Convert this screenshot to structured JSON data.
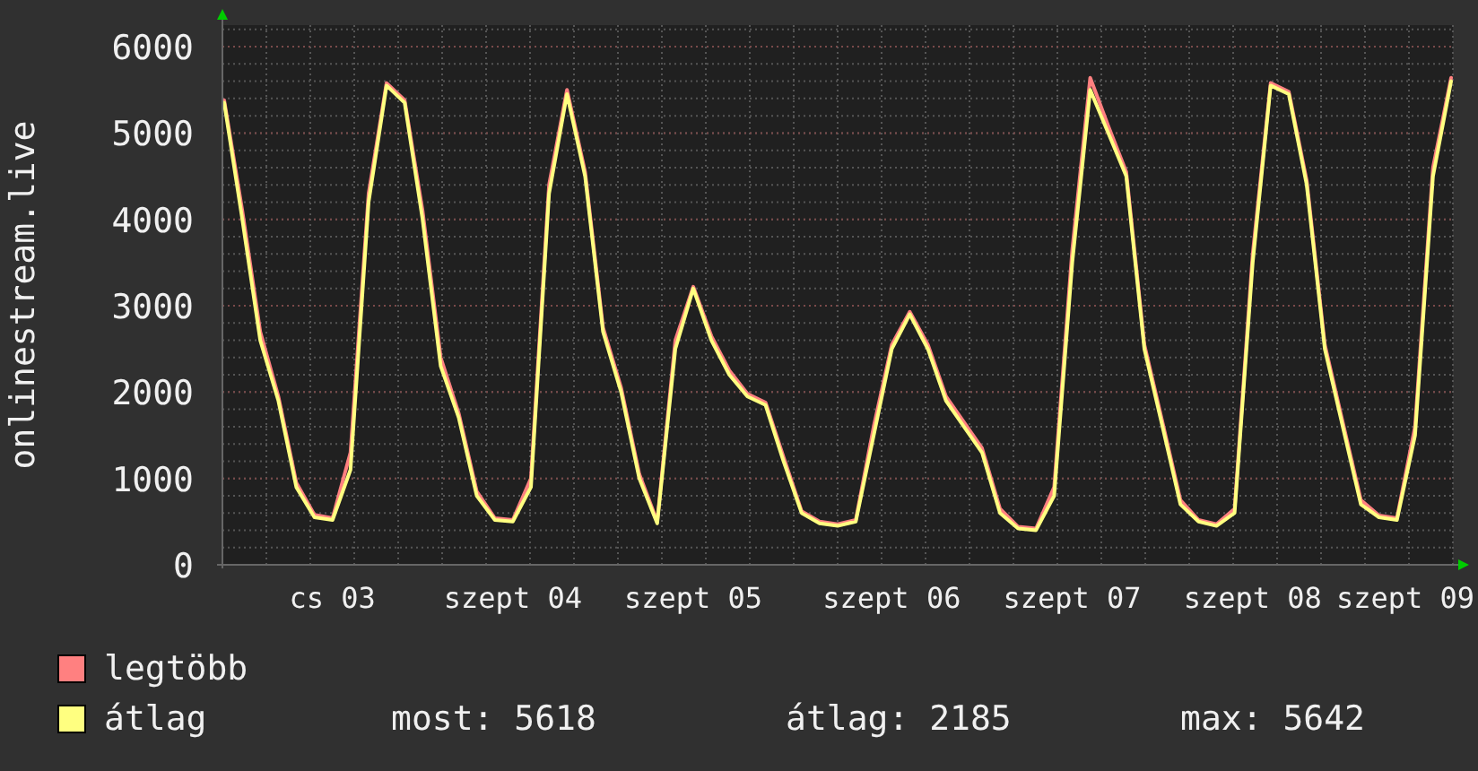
{
  "chart": {
    "chart_data": {
      "type": "line",
      "ylabel": "onlinestream.live",
      "categories": [
        null,
        null,
        null,
        null,
        null,
        null,
        "cs 03",
        null,
        null,
        null,
        null,
        null,
        null,
        null,
        null,
        null,
        "szept 04",
        null,
        null,
        null,
        null,
        null,
        null,
        null,
        null,
        null,
        "szept 05",
        null,
        null,
        null,
        null,
        null,
        null,
        null,
        null,
        null,
        null,
        "szept 06",
        null,
        null,
        null,
        null,
        null,
        null,
        null,
        null,
        null,
        "szept 07",
        null,
        null,
        null,
        null,
        null,
        null,
        null,
        null,
        null,
        "szept 08",
        null,
        null,
        null,
        null,
        null,
        null,
        null,
        null,
        "szept 09",
        null,
        null
      ],
      "ylim": [
        0,
        6250
      ],
      "grid": true,
      "yticks": [
        0,
        1000,
        2000,
        3000,
        4000,
        5000,
        6000
      ],
      "series": [
        {
          "name": "legtöbb",
          "color": "#ff8080",
          "values": [
            5380,
            4100,
            2700,
            1950,
            950,
            580,
            540,
            1300,
            4300,
            5580,
            5380,
            4100,
            2400,
            1750,
            850,
            540,
            520,
            1000,
            4400,
            5500,
            4550,
            2750,
            2050,
            1050,
            500,
            2600,
            3220,
            2650,
            2250,
            1980,
            1880,
            1250,
            620,
            500,
            470,
            520,
            1600,
            2550,
            2930,
            2550,
            1950,
            1650,
            1350,
            650,
            440,
            420,
            900,
            3650,
            5640,
            5080,
            4550,
            2550,
            1650,
            750,
            520,
            470,
            650,
            3600,
            5580,
            5480,
            4450,
            2550,
            1650,
            750,
            570,
            540,
            1600,
            4600,
            5640
          ]
        },
        {
          "name": "átlag",
          "color": "#ffff80",
          "values": [
            5350,
            4000,
            2600,
            1900,
            900,
            550,
            520,
            1100,
            4200,
            5550,
            5350,
            4000,
            2300,
            1700,
            800,
            520,
            500,
            900,
            4300,
            5450,
            4500,
            2700,
            2000,
            1000,
            480,
            2500,
            3200,
            2600,
            2200,
            1950,
            1850,
            1200,
            600,
            480,
            450,
            500,
            1500,
            2500,
            2900,
            2500,
            1900,
            1600,
            1300,
            600,
            420,
            400,
            800,
            3500,
            5500,
            5000,
            4500,
            2500,
            1600,
            700,
            500,
            450,
            600,
            3500,
            5550,
            5450,
            4400,
            2500,
            1600,
            700,
            550,
            520,
            1500,
            4500,
            5600
          ]
        }
      ]
    }
  },
  "legend_stats": [
    "most: 5618",
    "átlag: 2185",
    "max: 5642"
  ]
}
